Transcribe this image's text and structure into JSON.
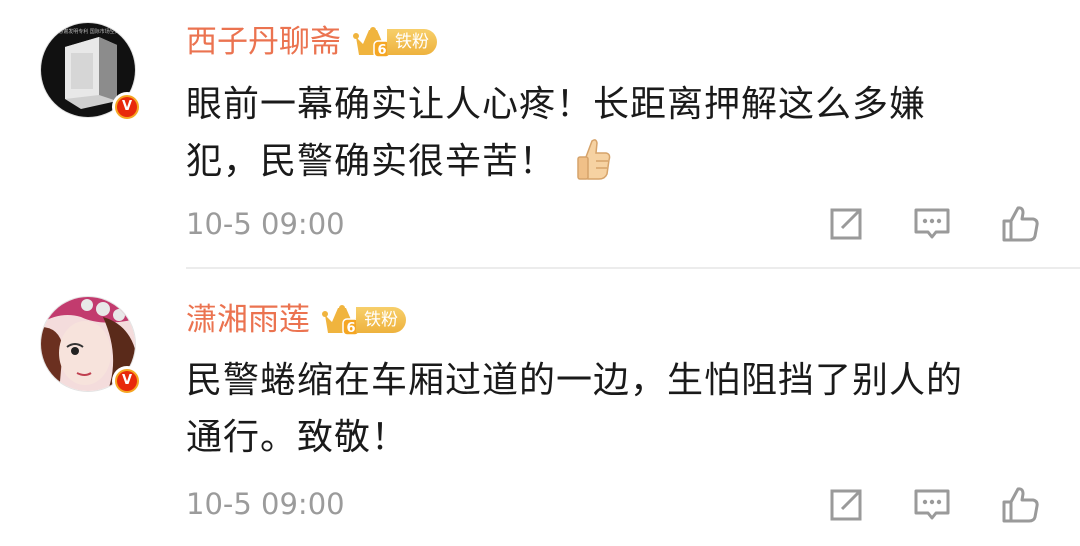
{
  "comments": [
    {
      "username": "西子丹聊斋",
      "fan_badge": {
        "level": "6",
        "label": "铁粉"
      },
      "avatar_caption": "感谢发明专利 国际市场空白",
      "content_lines": [
        "眼前一幕确实让人心疼！长距离押解这么多嫌",
        "犯，民警确实很辛苦！"
      ],
      "emoji": "thumbs-up",
      "timestamp": "10-5 09:00"
    },
    {
      "username": "潇湘雨莲",
      "fan_badge": {
        "level": "6",
        "label": "铁粉"
      },
      "content_lines": [
        "民警蜷缩在车厢过道的一边，生怕阻挡了别人的",
        "通行。致敬！"
      ],
      "timestamp": "10-5 09:00"
    }
  ],
  "verified_mark": "V",
  "icons": {
    "forward": "share-square-icon",
    "comment": "comment-bubble-icon",
    "like": "thumbs-up-outline-icon"
  },
  "colors": {
    "username": "#eb7350",
    "timestamp": "#9b9b9b",
    "badge_gold": "#f0b43e",
    "verified": "#e8290b"
  }
}
